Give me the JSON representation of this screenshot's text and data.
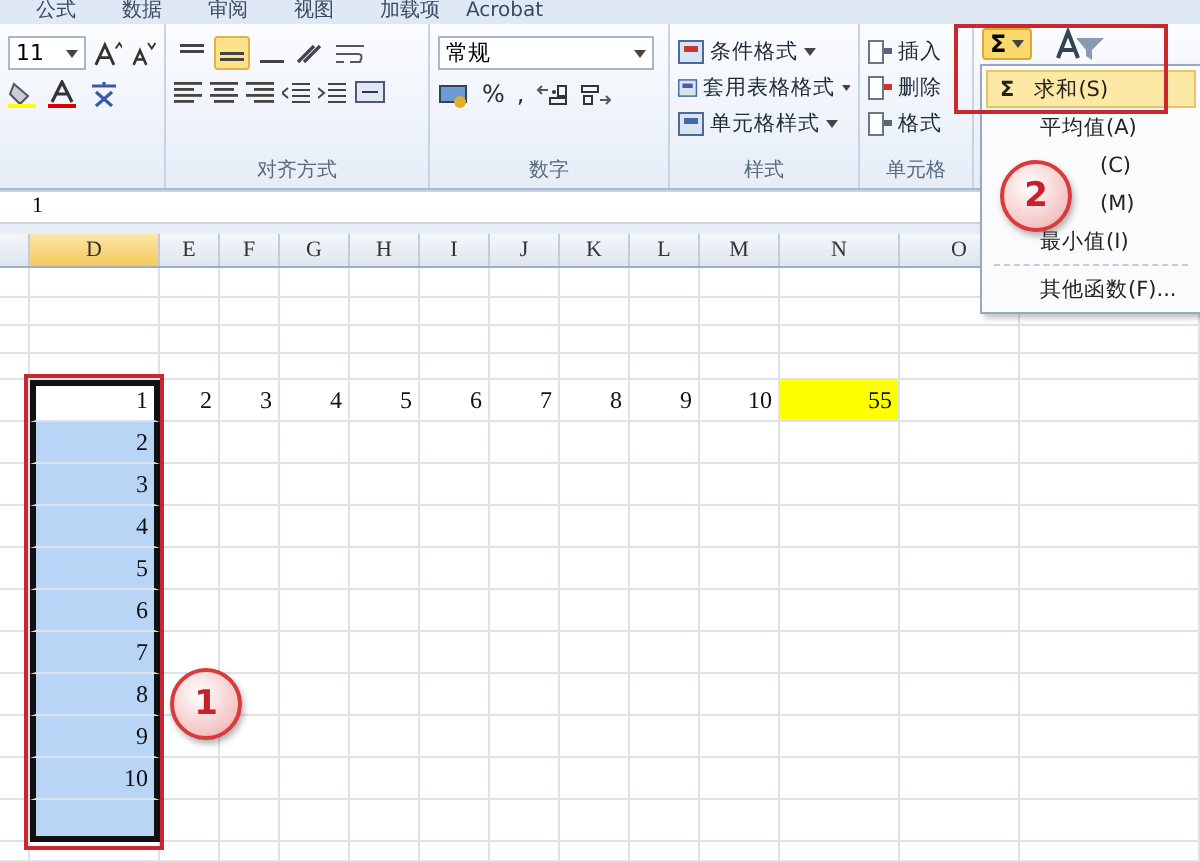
{
  "ribbon_tabs": [
    {
      "label": "公式"
    },
    {
      "label": "数据"
    },
    {
      "label": "审阅"
    },
    {
      "label": "视图"
    },
    {
      "label": "加载项"
    },
    {
      "label": "Acrobat"
    }
  ],
  "font_group": {
    "font_size": "11"
  },
  "alignment_group": {
    "label": "对齐方式",
    "vertical_align": [
      {
        "selected": false
      },
      {
        "selected": true
      },
      {
        "selected": false
      }
    ]
  },
  "number_group": {
    "label": "数字",
    "format": "常规",
    "buttons": [
      "%",
      ","
    ]
  },
  "styles_group": {
    "label": "样式",
    "items": [
      "条件格式",
      "套用表格格式",
      "单元格样式"
    ]
  },
  "cells_group": {
    "label": "单元格",
    "items": [
      "插入",
      "删除",
      "格式"
    ]
  },
  "autosum_button": {
    "symbol": "Σ",
    "selected": true
  },
  "autosum_menu": {
    "items": [
      {
        "symbol": "Σ",
        "label": "求和(S)",
        "selected": true,
        "kind": "full"
      },
      {
        "label": "平均值(A)",
        "selected": false,
        "kind": "full"
      },
      {
        "label": "(C)",
        "selected": false,
        "kind": "partial"
      },
      {
        "label": "(M)",
        "selected": false,
        "kind": "partial"
      },
      {
        "label": "最小值(I)",
        "selected": false,
        "kind": "full"
      },
      {
        "label": "其他函数(F)...",
        "selected": false,
        "kind": "full"
      }
    ]
  },
  "formula_bar": {
    "value": "1"
  },
  "columns": [
    {
      "label": "D",
      "selected": true
    },
    {
      "label": "E",
      "selected": false
    },
    {
      "label": "F",
      "selected": false
    },
    {
      "label": "G",
      "selected": false
    },
    {
      "label": "H",
      "selected": false
    },
    {
      "label": "I",
      "selected": false
    },
    {
      "label": "J",
      "selected": false
    },
    {
      "label": "K",
      "selected": false
    },
    {
      "label": "L",
      "selected": false
    },
    {
      "label": "M",
      "selected": false
    },
    {
      "label": "N",
      "selected": false
    },
    {
      "label": "O",
      "selected": false
    }
  ],
  "data_row": [
    {
      "value": "1",
      "selected": true,
      "active": true,
      "highlighted": false
    },
    {
      "value": "2",
      "selected": false,
      "highlighted": false
    },
    {
      "value": "3",
      "selected": false,
      "highlighted": false
    },
    {
      "value": "4",
      "selected": false,
      "highlighted": false
    },
    {
      "value": "5",
      "selected": false,
      "highlighted": false
    },
    {
      "value": "6",
      "selected": false,
      "highlighted": false
    },
    {
      "value": "7",
      "selected": false,
      "highlighted": false
    },
    {
      "value": "8",
      "selected": false,
      "highlighted": false
    },
    {
      "value": "9",
      "selected": false,
      "highlighted": false
    },
    {
      "value": "10",
      "selected": false,
      "highlighted": false
    },
    {
      "value": "55",
      "selected": false,
      "highlighted": true
    }
  ],
  "column_d_cells": [
    {
      "value": "2",
      "selected": true
    },
    {
      "value": "3",
      "selected": true
    },
    {
      "value": "4",
      "selected": true
    },
    {
      "value": "5",
      "selected": true
    },
    {
      "value": "6",
      "selected": true
    },
    {
      "value": "7",
      "selected": true
    },
    {
      "value": "8",
      "selected": true
    },
    {
      "value": "9",
      "selected": true
    },
    {
      "value": "10",
      "selected": true
    },
    {
      "selected": true
    }
  ],
  "callouts": [
    {
      "label": "1"
    },
    {
      "label": "2"
    }
  ]
}
